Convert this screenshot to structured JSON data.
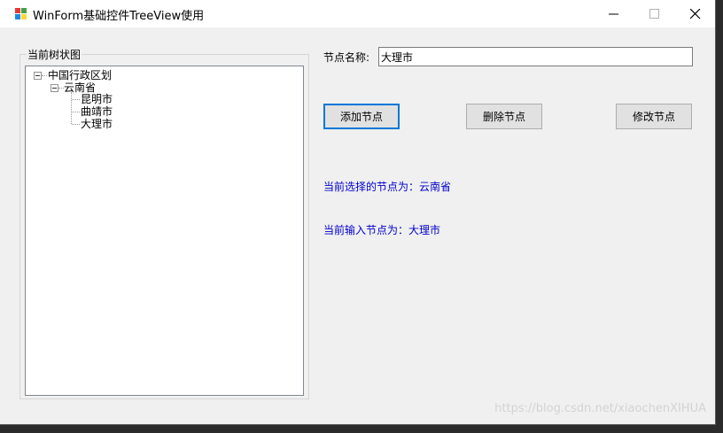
{
  "window": {
    "title": "WinForm基础控件TreeView使用",
    "minimize_icon": "minimize-icon",
    "maximize_icon": "maximize-icon",
    "close_icon": "close-icon"
  },
  "groupbox": {
    "title": "当前树状图"
  },
  "tree": {
    "root": {
      "label": "中国行政区划",
      "expanded": true
    },
    "province": {
      "label": "云南省",
      "expanded": true
    },
    "cities": [
      "昆明市",
      "曲靖市",
      "大理市"
    ]
  },
  "form": {
    "node_name_label": "节点名称:",
    "node_name_value": "大理市"
  },
  "buttons": {
    "add": "添加节点",
    "delete": "删除节点",
    "edit": "修改节点"
  },
  "status": {
    "selected": "当前选择的节点为：云南省",
    "input": "当前输入节点为：大理市"
  },
  "watermark": "https://blog.csdn.net/xiaochenXIHUA",
  "colors": {
    "status_text": "#0000cd",
    "focus_border": "#0078d7",
    "window_bg": "#f0f0f0"
  }
}
